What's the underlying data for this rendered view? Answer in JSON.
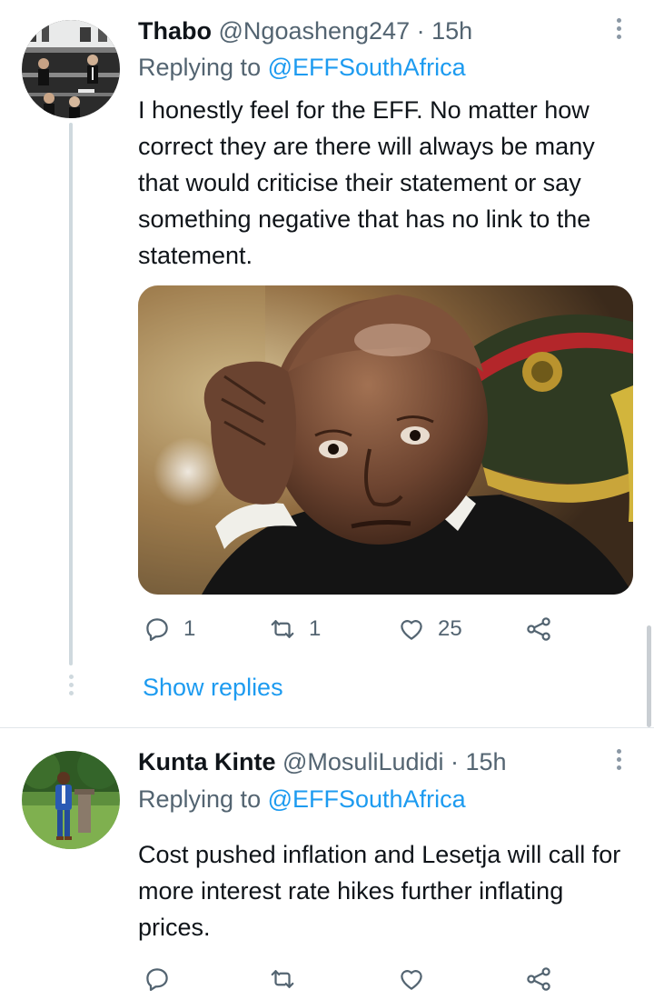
{
  "tweets": [
    {
      "name": "Thabo",
      "handle": "@Ngoasheng247",
      "time": "· 15h",
      "replying_prefix": "Replying to",
      "replying_handle": "@EFFSouthAfrica",
      "text": "I honestly feel for the EFF. No matter how correct they are there will always be many that would criticise their statement or say something negative that has no link to the statement.",
      "media": "photo",
      "reply_count": "1",
      "retweet_count": "1",
      "like_count": "25",
      "show_replies": "Show replies"
    },
    {
      "name": "Kunta Kinte",
      "handle": "@MosuliLudidi",
      "time": "· 15h",
      "replying_prefix": "Replying to",
      "replying_handle": "@EFFSouthAfrica",
      "text": "Cost pushed inflation and Lesetja will call for more interest rate hikes further inflating prices."
    }
  ],
  "icons": {
    "reply": "reply-icon",
    "retweet": "retweet-icon",
    "like": "heart-icon",
    "share": "share-icon",
    "more": "more-vertical-icon"
  },
  "colors": {
    "accent": "#1d9bf0",
    "secondary_text": "#536471",
    "thread_line": "#cfd9de"
  }
}
